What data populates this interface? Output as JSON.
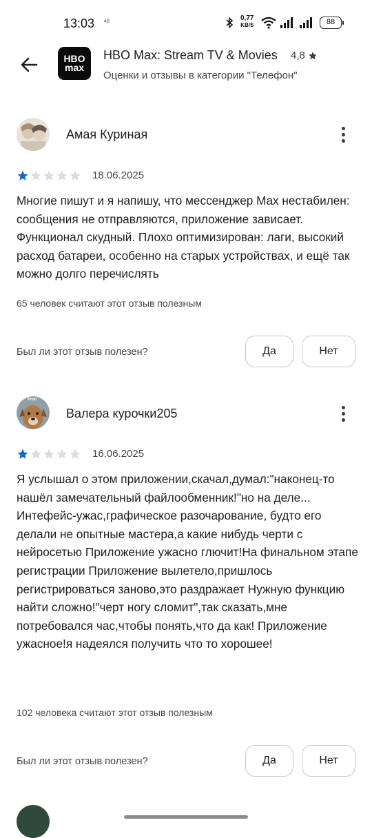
{
  "status_bar": {
    "time": "13:03",
    "sim_label": "⁴ᴵˡ",
    "speed_value": "0,77",
    "speed_unit": "KB/S",
    "battery": "88"
  },
  "header": {
    "app_name": "HBO Max: Stream TV & Movies",
    "rating": "4,8",
    "subtitle": "Оценки и отзывы в категории \"Телефон\"",
    "logo_line1": "HBO",
    "logo_line2": "max"
  },
  "colors": {
    "star_filled": "#1a66c4",
    "star_empty": "#dadce0"
  },
  "reviews": [
    {
      "name": "Амая Куриная",
      "rating": 1,
      "date": "18.06.2025",
      "text": "Многие пишут и я напишу, что мессенджер Max нестабилен: сообщения не отправляются, приложение зависает. Функционал скудный. Плохо оптимизирован: лаги, высокий расход батареи, особенно на старых устройствах, и ещё так можно долго перечислять",
      "helpful": "65 человек считают этот отзыв полезным",
      "question": "Был ли этот отзыв полезен?",
      "yes": "Да",
      "no": "Нет"
    },
    {
      "name": "Валера курочки205",
      "rating": 1,
      "date": "16.06.2025",
      "avatar_label": "Froo",
      "text": "Я услышал о этом приложении,скачал,думал:\"наконец-то нашёл замечательный файлообменник!\"но на деле... Интефейс-ужас,графическое разочарование, будто его делали не опытные мастера,а какие нибудь черти с нейросетью Приложение ужасно глючит!На финальном этапе регистрации Приложение вылетело,пришлось регистрироваться заново,это раздражает Нужную функцию найти сложно!\"черт ногу сломит\",так сказать,мне потребовался час,чтобы понять,что да как! Приложение ужасное!я надеялся получить что то хорошее!",
      "helpful": "102 человека считают этот отзыв полезным",
      "question": "Был ли этот отзыв полезен?",
      "yes": "Да",
      "no": "Нет"
    }
  ]
}
